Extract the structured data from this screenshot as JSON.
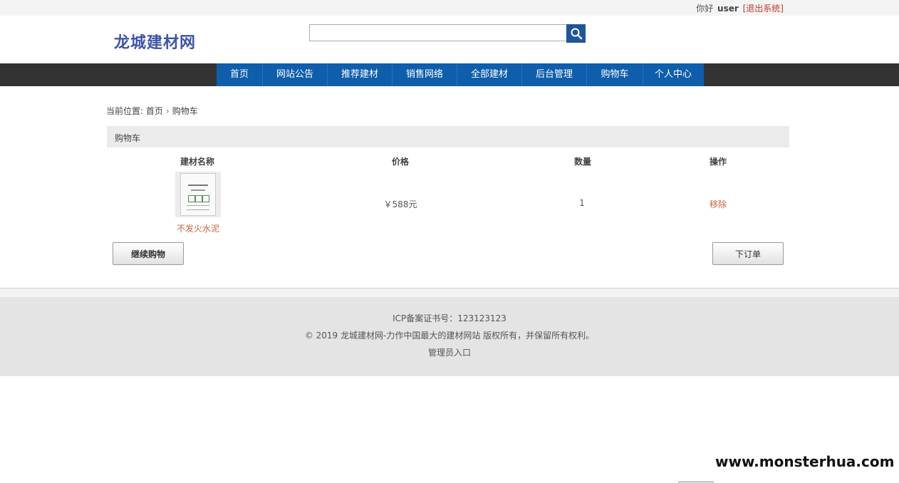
{
  "topbar": {
    "greeting": "你好",
    "username": "user",
    "logout": "[退出系统]"
  },
  "header": {
    "logo": "龙城建材网",
    "search_placeholder": ""
  },
  "nav": {
    "items": [
      {
        "label": "首页"
      },
      {
        "label": "网站公告"
      },
      {
        "label": "推荐建材"
      },
      {
        "label": "销售网络"
      },
      {
        "label": "全部建材"
      },
      {
        "label": "后台管理"
      },
      {
        "label": "购物车"
      },
      {
        "label": "个人中心"
      }
    ]
  },
  "breadcrumb": {
    "prefix": "当前位置:",
    "home": "首页",
    "current": "购物车"
  },
  "cart": {
    "title": "购物车",
    "columns": [
      "建材名称",
      "价格",
      "数量",
      "操作"
    ],
    "rows": [
      {
        "name": "不发火水泥",
        "price": "￥588元",
        "quantity": "1",
        "action": "移除"
      }
    ],
    "continue_label": "继续购物",
    "order_label": "下订单"
  },
  "footer": {
    "icp": "ICP备案证书号：123123123",
    "copyright": "© 2019 龙城建材网-力作中国最大的建材网站 版权所有，并保留所有权利。",
    "admin_link": "管理员入口"
  },
  "watermark": "www.monsterhua.com",
  "colors": {
    "nav_bg": "#0e5eab",
    "navbar_bg": "#333333",
    "accent": "#c8643c",
    "logo": "#3d54a8"
  },
  "icons": {
    "search": "search-icon"
  }
}
